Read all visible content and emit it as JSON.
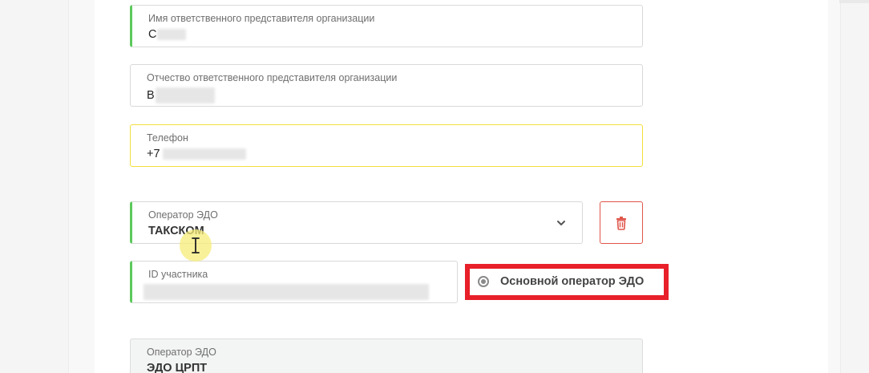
{
  "form": {
    "contact_first_name": {
      "label": "Имя ответственного представителя организации",
      "value": "С"
    },
    "contact_patronymic": {
      "label": "Отчество ответственного представителя организации",
      "value": "В"
    },
    "phone": {
      "label": "Телефон",
      "value": "+7"
    },
    "edo_operator_1": {
      "label": "Оператор ЭДО",
      "value": "ТАКСКОМ",
      "chevron_icon": "chevron-down-icon"
    },
    "delete_button": {
      "icon": "trash-icon",
      "color": "#e0554a"
    },
    "participant_id": {
      "label": "ID участника",
      "value": ""
    },
    "main_operator_radio": {
      "label": "Основной оператор ЭДО",
      "checked": true,
      "highlight_color": "#e8202a"
    },
    "edo_operator_2": {
      "label": "Оператор ЭДО",
      "value": "ЭДО ЦРПТ"
    }
  },
  "colors": {
    "accent_green": "#5cc95c",
    "focus_yellow": "#f2df3b",
    "danger_red": "#e0554a"
  }
}
